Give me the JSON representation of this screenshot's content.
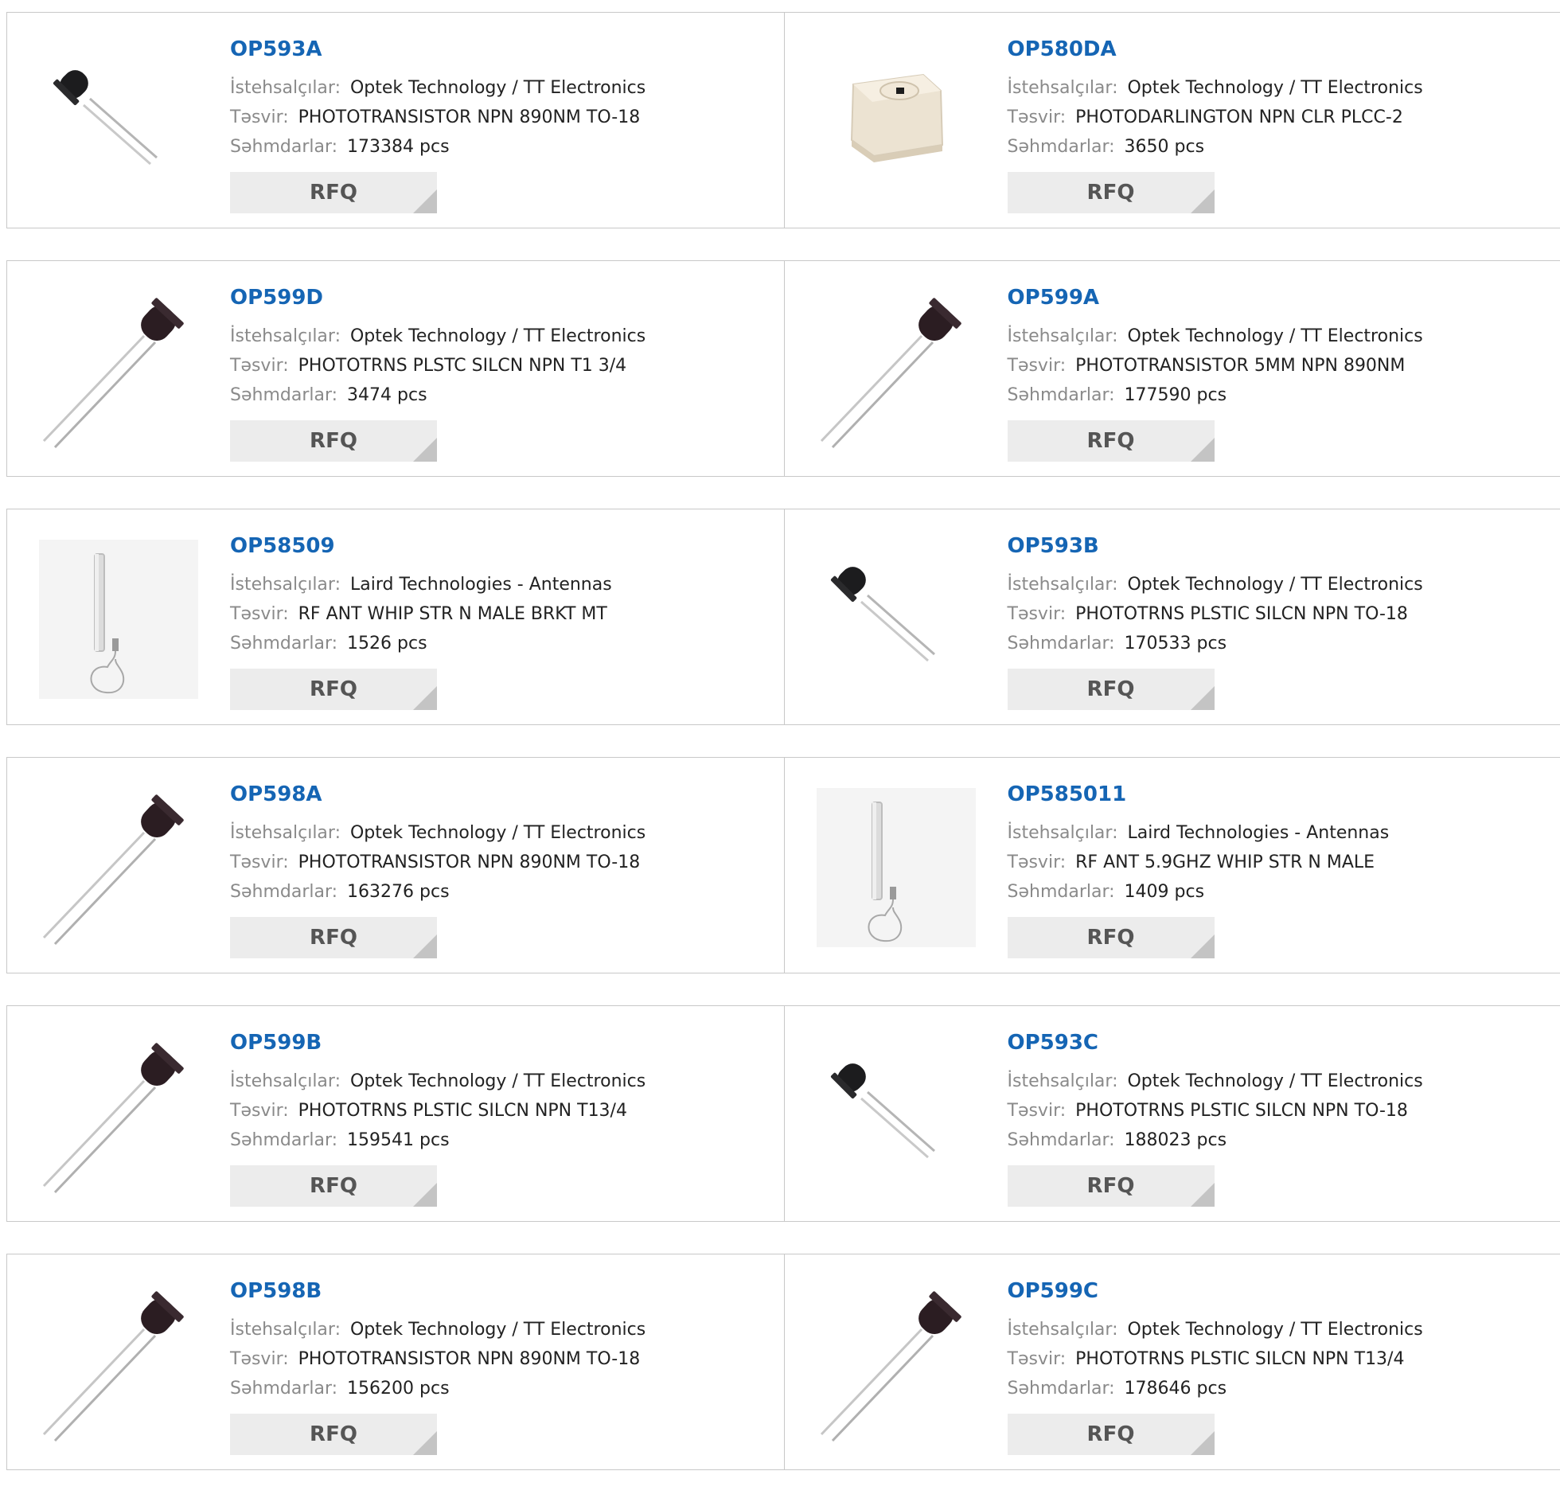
{
  "labels": {
    "manufacturer": "İstehsalçılar:",
    "description": "Təsvir:",
    "stock": "Səhmdarlar:",
    "rfq": "RFQ"
  },
  "colors": {
    "part_link": "#1565b4",
    "rfq_bg": "#ececec",
    "border": "#c8c8c8"
  },
  "products": [
    {
      "part": "OP593A",
      "manufacturer": "Optek Technology / TT Electronics",
      "description": "PHOTOTRANSISTOR NPN 890NM TO-18",
      "stock": "173384 pcs",
      "image": "small-phototransistor-icon"
    },
    {
      "part": "OP580DA",
      "manufacturer": "Optek Technology / TT Electronics",
      "description": "PHOTODARLINGTON NPN CLR PLCC-2",
      "stock": "3650 pcs",
      "image": "smd-chip-icon"
    },
    {
      "part": "OP599D",
      "manufacturer": "Optek Technology / TT Electronics",
      "description": "PHOTOTRNS PLSTC SILCN NPN T1 3/4",
      "stock": "3474 pcs",
      "image": "5mm-phototransistor-icon"
    },
    {
      "part": "OP599A",
      "manufacturer": "Optek Technology / TT Electronics",
      "description": "PHOTOTRANSISTOR 5MM NPN 890NM",
      "stock": "177590 pcs",
      "image": "5mm-phototransistor-icon"
    },
    {
      "part": "OP58509",
      "manufacturer": "Laird Technologies - Antennas",
      "description": "RF ANT WHIP STR N MALE BRKT MT",
      "stock": "1526 pcs",
      "image": "whip-antenna-icon"
    },
    {
      "part": "OP593B",
      "manufacturer": "Optek Technology / TT Electronics",
      "description": "PHOTOTRNS PLSTIC SILCN NPN TO-18",
      "stock": "170533 pcs",
      "image": "small-phototransistor-icon"
    },
    {
      "part": "OP598A",
      "manufacturer": "Optek Technology / TT Electronics",
      "description": "PHOTOTRANSISTOR NPN 890NM TO-18",
      "stock": "163276 pcs",
      "image": "5mm-phototransistor-icon"
    },
    {
      "part": "OP585011",
      "manufacturer": "Laird Technologies - Antennas",
      "description": "RF ANT 5.9GHZ WHIP STR N MALE",
      "stock": "1409 pcs",
      "image": "whip-antenna-icon"
    },
    {
      "part": "OP599B",
      "manufacturer": "Optek Technology / TT Electronics",
      "description": "PHOTOTRNS PLSTIC SILCN NPN T13/4",
      "stock": "159541 pcs",
      "image": "5mm-phototransistor-icon"
    },
    {
      "part": "OP593C",
      "manufacturer": "Optek Technology / TT Electronics",
      "description": "PHOTOTRNS PLSTIC SILCN NPN TO-18",
      "stock": "188023 pcs",
      "image": "small-phototransistor-icon"
    },
    {
      "part": "OP598B",
      "manufacturer": "Optek Technology / TT Electronics",
      "description": "PHOTOTRANSISTOR NPN 890NM TO-18",
      "stock": "156200 pcs",
      "image": "5mm-phototransistor-icon"
    },
    {
      "part": "OP599C",
      "manufacturer": "Optek Technology / TT Electronics",
      "description": "PHOTOTRNS PLSTIC SILCN NPN T13/4",
      "stock": "178646 pcs",
      "image": "5mm-phototransistor-icon"
    }
  ]
}
